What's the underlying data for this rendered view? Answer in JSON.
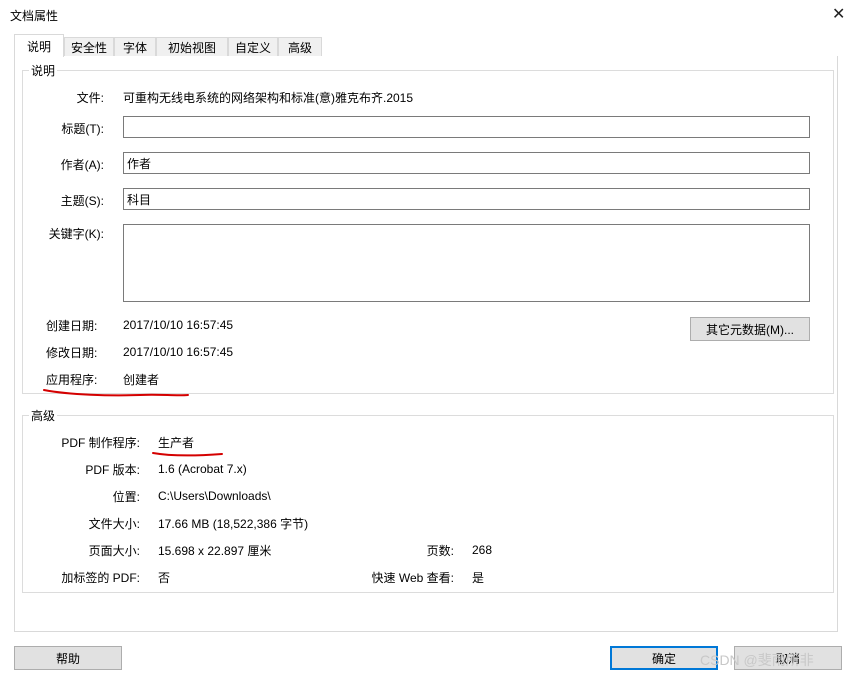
{
  "window": {
    "title": "文档属性"
  },
  "tabs": [
    {
      "label": "说明"
    },
    {
      "label": "安全性"
    },
    {
      "label": "字体"
    },
    {
      "label": "初始视图"
    },
    {
      "label": "自定义"
    },
    {
      "label": "高级"
    }
  ],
  "description": {
    "group_title": "说明",
    "file_label": "文件:",
    "file_value": "可重构无线电系统的网络架构和标准(意)雅克布齐.2015",
    "title_label": "标题(T):",
    "title_value": "",
    "author_label": "作者(A):",
    "author_value": "作者",
    "subject_label": "主题(S):",
    "subject_value": "科目",
    "keywords_label": "关键字(K):",
    "keywords_value": "",
    "created_label": "创建日期:",
    "created_value": "2017/10/10 16:57:45",
    "modified_label": "修改日期:",
    "modified_value": "2017/10/10 16:57:45",
    "app_label": "应用程序:",
    "app_value": "创建者",
    "metadata_button": "其它元数据(M)..."
  },
  "advanced": {
    "group_title": "高级",
    "producer_label": "PDF 制作程序:",
    "producer_value": "生产者",
    "version_label": "PDF 版本:",
    "version_value": "1.6 (Acrobat 7.x)",
    "location_label": "位置:",
    "location_value": "C:\\Users\\Downloads\\",
    "filesize_label": "文件大小:",
    "filesize_value": "17.66 MB (18,522,386 字节)",
    "pagesize_label": "页面大小:",
    "pagesize_value": "15.698 x 22.897 厘米",
    "pages_label": "页数:",
    "pages_value": "268",
    "tagged_label": "加标签的 PDF:",
    "tagged_value": "否",
    "fastweb_label": "快速 Web 查看:",
    "fastweb_value": "是"
  },
  "footer": {
    "help_button": "帮助",
    "ok_button": "确定",
    "cancel_button": "取消"
  },
  "watermark": "CSDN @斐雨所非",
  "colors": {
    "annotation": "#d40000",
    "focus": "#0078d7"
  }
}
